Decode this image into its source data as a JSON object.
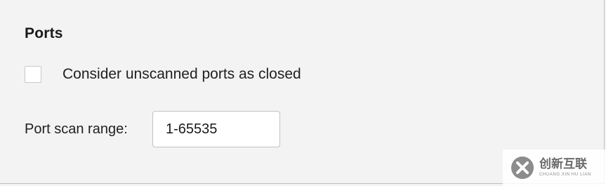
{
  "section": {
    "title": "Ports"
  },
  "unscanned": {
    "label": "Consider unscanned ports as closed",
    "checked": false
  },
  "range": {
    "label": "Port scan range:",
    "value": "1-65535"
  },
  "watermark": {
    "chinese": "创新互联",
    "english": "CHUANG XIN HU LIAN"
  },
  "colors": {
    "background": "#f3f3f3",
    "input_border": "#c2c2c2",
    "checkbox_border": "#c9c9c9"
  }
}
